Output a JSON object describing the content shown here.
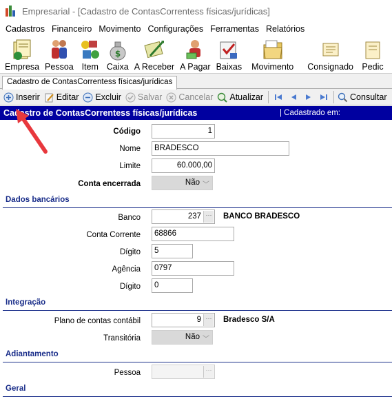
{
  "window": {
    "title": "Empresarial - [Cadastro de ContasCorrentess físicas/jurídicas]"
  },
  "menu": [
    "Cadastros",
    "Financeiro",
    "Movimento",
    "Configurações",
    "Ferramentas",
    "Relatórios"
  ],
  "toolbar": {
    "empresa": "Empresa",
    "pessoa": "Pessoa",
    "item": "Item",
    "caixa": "Caixa",
    "a_receber": "A Receber",
    "a_pagar": "A Pagar",
    "baixas": "Baixas",
    "movimento": "Movimento",
    "consignado": "Consignado",
    "pedidos": "Pedic"
  },
  "tab": {
    "label": "Cadastro de ContasCorrentess físicas/jurídicas"
  },
  "actions": {
    "inserir": "Inserir",
    "editar": "Editar",
    "excluir": "Excluir",
    "salvar": "Salvar",
    "cancelar": "Cancelar",
    "atualizar": "Atualizar",
    "consultar": "Consultar"
  },
  "form": {
    "title": "Cadastro de ContasCorrentess físicas/jurídicas",
    "cadastrado_em": "| Cadastrado em:",
    "codigo": {
      "label": "Código",
      "value": "1"
    },
    "nome": {
      "label": "Nome",
      "value": "BRADESCO"
    },
    "limite": {
      "label": "Limite",
      "value": "60.000,00"
    },
    "conta_encerrada": {
      "label": "Conta encerrada",
      "value": "Não"
    },
    "sections": {
      "dados_bancarios": "Dados bancários",
      "integracao": "Integração",
      "adiantamento": "Adiantamento",
      "geral": "Geral"
    },
    "banco": {
      "label": "Banco",
      "value": "237",
      "description": "BANCO BRADESCO"
    },
    "conta_corrente": {
      "label": "Conta Corrente",
      "value": "68866"
    },
    "digito_conta": {
      "label": "Dígito",
      "value": "5"
    },
    "agencia": {
      "label": "Agência",
      "value": "0797"
    },
    "digito_agencia": {
      "label": "Dígito",
      "value": "0"
    },
    "plano_contas": {
      "label": "Plano de contas contábil",
      "value": "9",
      "description": "Bradesco S/A"
    },
    "transitoria": {
      "label": "Transitória",
      "value": "Não"
    },
    "pessoa": {
      "label": "Pessoa",
      "value": ""
    },
    "lookup_dots": "···"
  },
  "colors": {
    "header_bg": "#0000a0",
    "section_text": "#1a2e8a",
    "arrow": "#e8383d"
  }
}
